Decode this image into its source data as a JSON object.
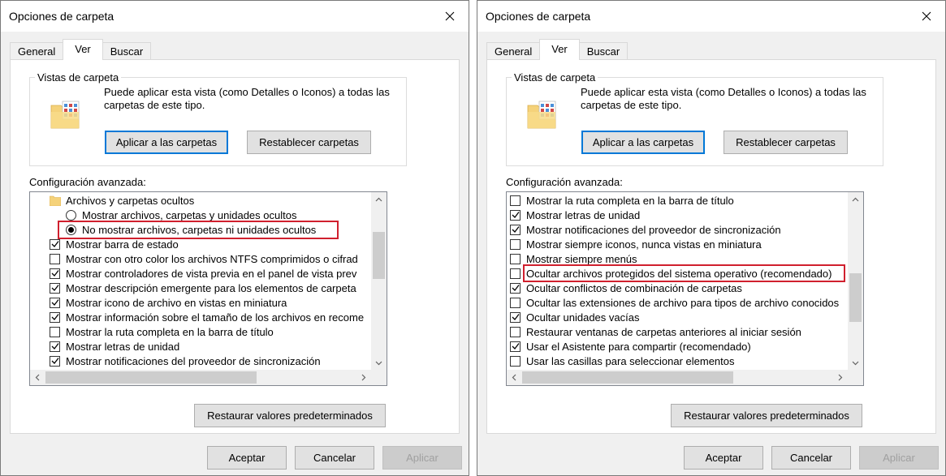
{
  "left": {
    "title": "Opciones de carpeta",
    "tabs": [
      "General",
      "Ver",
      "Buscar"
    ],
    "group_legend": "Vistas de carpeta",
    "group_desc": "Puede aplicar esta vista (como Detalles o Iconos) a todas las carpetas de este tipo.",
    "apply_folders": "Aplicar a las carpetas",
    "reset_folders": "Restablecer carpetas",
    "adv_label": "Configuración avanzada:",
    "items": [
      {
        "type": "folder",
        "label": "Archivos y carpetas ocultos"
      },
      {
        "type": "radio",
        "checked": false,
        "label": "Mostrar archivos, carpetas y unidades ocultos"
      },
      {
        "type": "radio",
        "checked": true,
        "label": "No mostrar archivos, carpetas ni unidades ocultos"
      },
      {
        "type": "check",
        "checked": true,
        "label": "Mostrar barra de estado"
      },
      {
        "type": "check",
        "checked": false,
        "label": "Mostrar con otro color los archivos NTFS comprimidos o cifrad"
      },
      {
        "type": "check",
        "checked": true,
        "label": "Mostrar controladores de vista previa en el panel de vista prev"
      },
      {
        "type": "check",
        "checked": true,
        "label": "Mostrar descripción emergente para los elementos de carpeta"
      },
      {
        "type": "check",
        "checked": true,
        "label": "Mostrar icono de archivo en vistas en miniatura"
      },
      {
        "type": "check",
        "checked": true,
        "label": "Mostrar información sobre el tamaño de los archivos en recome"
      },
      {
        "type": "check",
        "checked": false,
        "label": "Mostrar la ruta completa en la barra de título"
      },
      {
        "type": "check",
        "checked": true,
        "label": "Mostrar letras de unidad"
      },
      {
        "type": "check",
        "checked": true,
        "label": "Mostrar notificaciones del proveedor de sincronización"
      }
    ],
    "restore": "Restaurar valores predeterminados",
    "accept": "Aceptar",
    "cancel": "Cancelar",
    "apply": "Aplicar"
  },
  "right": {
    "title": "Opciones de carpeta",
    "tabs": [
      "General",
      "Ver",
      "Buscar"
    ],
    "group_legend": "Vistas de carpeta",
    "group_desc": "Puede aplicar esta vista (como Detalles o Iconos) a todas las carpetas de este tipo.",
    "apply_folders": "Aplicar a las carpetas",
    "reset_folders": "Restablecer carpetas",
    "adv_label": "Configuración avanzada:",
    "items": [
      {
        "type": "check",
        "checked": false,
        "label": "Mostrar la ruta completa en la barra de título"
      },
      {
        "type": "check",
        "checked": true,
        "label": "Mostrar letras de unidad"
      },
      {
        "type": "check",
        "checked": true,
        "label": "Mostrar notificaciones del proveedor de sincronización"
      },
      {
        "type": "check",
        "checked": false,
        "label": "Mostrar siempre iconos, nunca vistas en miniatura"
      },
      {
        "type": "check",
        "checked": false,
        "label": "Mostrar siempre menús"
      },
      {
        "type": "check",
        "checked": false,
        "label": "Ocultar archivos protegidos del sistema operativo (recomendado)"
      },
      {
        "type": "check",
        "checked": true,
        "label": "Ocultar conflictos de combinación de carpetas"
      },
      {
        "type": "check",
        "checked": false,
        "label": "Ocultar las extensiones de archivo para tipos de archivo conocidos"
      },
      {
        "type": "check",
        "checked": true,
        "label": "Ocultar unidades vacías"
      },
      {
        "type": "check",
        "checked": false,
        "label": "Restaurar ventanas de carpetas anteriores al iniciar sesión"
      },
      {
        "type": "check",
        "checked": true,
        "label": "Usar el Asistente para compartir (recomendado)"
      },
      {
        "type": "check",
        "checked": false,
        "label": "Usar las casillas para seleccionar elementos"
      }
    ],
    "restore": "Restaurar valores predeterminados",
    "accept": "Aceptar",
    "cancel": "Cancelar",
    "apply": "Aplicar"
  },
  "colors": {
    "highlight": "#d0202e",
    "default_button_border": "#0078d7"
  }
}
